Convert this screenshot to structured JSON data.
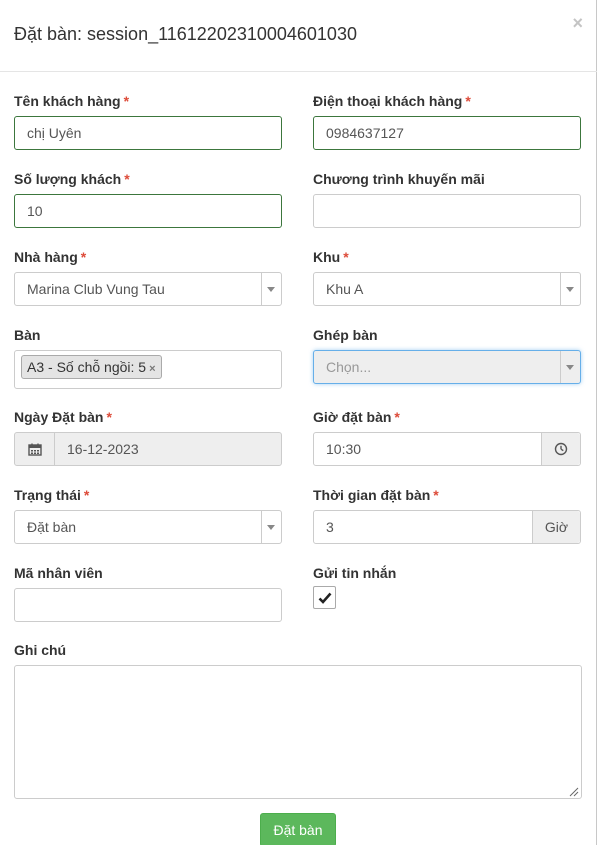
{
  "header": {
    "title": "Đặt bàn: session_11612202310004601030",
    "close_label": "×"
  },
  "form": {
    "customer_name": {
      "label": "Tên khách hàng",
      "required": "*",
      "value": "chị Uyên"
    },
    "customer_phone": {
      "label": "Điện thoại khách hàng",
      "required": "*",
      "value": "0984637127"
    },
    "guest_count": {
      "label": "Số lượng khách",
      "required": "*",
      "value": "10"
    },
    "promotion": {
      "label": "Chương trình khuyến mãi",
      "value": ""
    },
    "restaurant": {
      "label": "Nhà hàng",
      "required": "*",
      "selected": "Marina Club Vung Tau"
    },
    "area": {
      "label": "Khu",
      "required": "*",
      "selected": "Khu A"
    },
    "table": {
      "label": "Bàn",
      "tags": [
        "A3 - Số chỗ ngồi: 5"
      ],
      "tag_remove": "×"
    },
    "merge_table": {
      "label": "Ghép bàn",
      "placeholder": "Chọn..."
    },
    "booking_date": {
      "label": "Ngày Đặt bàn",
      "required": "*",
      "value": "16-12-2023",
      "icon": "calendar-icon"
    },
    "booking_time": {
      "label": "Giờ đặt bàn",
      "required": "*",
      "value": "10:30",
      "icon": "clock-icon"
    },
    "status": {
      "label": "Trạng thái",
      "required": "*",
      "selected": "Đặt bàn"
    },
    "duration": {
      "label": "Thời gian đặt bàn",
      "required": "*",
      "value": "3",
      "unit": "Giờ"
    },
    "staff_code": {
      "label": "Mã nhân viên",
      "value": ""
    },
    "send_sms": {
      "label": "Gửi tin nhắn",
      "checked": true
    },
    "note": {
      "label": "Ghi chú",
      "value": ""
    }
  },
  "footer": {
    "submit_label": "Đặt bàn"
  },
  "colors": {
    "success": "#5cb85c",
    "required": "#dd4b39",
    "valid_border": "#3c763d",
    "focus_border": "#66afe9"
  }
}
